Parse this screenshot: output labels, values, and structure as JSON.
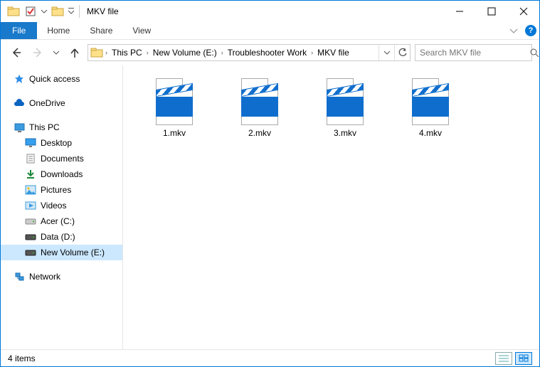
{
  "window": {
    "title": "MKV file"
  },
  "ribbon": {
    "file": "File",
    "tabs": [
      "Home",
      "Share",
      "View"
    ]
  },
  "breadcrumbs": [
    "This PC",
    "New Volume (E:)",
    "Troubleshooter Work",
    "MKV file"
  ],
  "search": {
    "placeholder": "Search MKV file"
  },
  "nav": {
    "quick_access": "Quick access",
    "onedrive": "OneDrive",
    "this_pc": "This PC",
    "children": [
      "Desktop",
      "Documents",
      "Downloads",
      "Pictures",
      "Videos",
      "Acer (C:)",
      "Data (D:)",
      "New Volume (E:)"
    ],
    "network": "Network"
  },
  "files": [
    "1.mkv",
    "2.mkv",
    "3.mkv",
    "4.mkv"
  ],
  "status": {
    "text": "4 items"
  }
}
